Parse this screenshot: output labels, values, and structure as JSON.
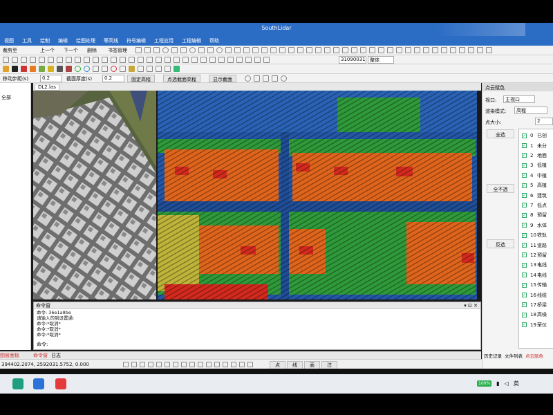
{
  "window": {
    "title": "SouthLidar"
  },
  "menu": [
    "视图",
    "工具",
    "绘制",
    "编辑",
    "绘图处理",
    "等高线",
    "符号编辑",
    "工程应用",
    "工程编辑",
    "帮助"
  ],
  "toolbar1": {
    "items": [
      "裁剪至",
      "上一个",
      "下一个",
      "删除",
      "书签管理"
    ],
    "code_value": "31090031",
    "code_mode": "整体"
  },
  "toolbar3": {
    "step_label": "移动步距(s)",
    "step_value": "0.2",
    "thickness_label": "截面厚度(s)",
    "thickness_value": "0.2",
    "btn_fix_elevation": "固定高程",
    "btn_pick_elevation": "点选截面高程",
    "btn_show_section": "显示截面"
  },
  "left_panel": {
    "label": "全部"
  },
  "doc_tab": "DL2.las",
  "command_window": {
    "header": "命令窗",
    "lines": [
      "命令: 36e1a8be",
      "请输入的到设置通:",
      "命令:*取消*",
      "命令:*取消*",
      "命令:*取消*"
    ],
    "prompt": "命令:"
  },
  "bottom_tabs": {
    "left": "图层面板",
    "cmd": "命令窗",
    "log": "日志"
  },
  "status": {
    "coords": "394402.2074, 2592031.5752, 0.000",
    "group_buttons": [
      "点",
      "线",
      "面",
      "注"
    ]
  },
  "right_panel": {
    "title": "点云赋色",
    "view_label": "视口:",
    "view_value": "主视口",
    "render_label": "渲染模式:",
    "render_value": "高程",
    "size_label": "点大小:",
    "size_value": "2",
    "btn_select_all": "全选",
    "btn_select_none": "全不选",
    "btn_invert": "反选",
    "classes": [
      {
        "num": "0",
        "name": "已创"
      },
      {
        "num": "1",
        "name": "未分"
      },
      {
        "num": "2",
        "name": "地面"
      },
      {
        "num": "3",
        "name": "低植"
      },
      {
        "num": "4",
        "name": "中植"
      },
      {
        "num": "5",
        "name": "高植"
      },
      {
        "num": "6",
        "name": "建筑"
      },
      {
        "num": "7",
        "name": "低点"
      },
      {
        "num": "8",
        "name": "预留"
      },
      {
        "num": "9",
        "name": "水体"
      },
      {
        "num": "10",
        "name": "铁轨"
      },
      {
        "num": "11",
        "name": "道路"
      },
      {
        "num": "12",
        "name": "预留"
      },
      {
        "num": "13",
        "name": "电线"
      },
      {
        "num": "14",
        "name": "电线"
      },
      {
        "num": "15",
        "name": "传输"
      },
      {
        "num": "16",
        "name": "线缆"
      },
      {
        "num": "17",
        "name": "桥梁"
      },
      {
        "num": "18",
        "name": "高噪"
      },
      {
        "num": "19",
        "name": "荣仪"
      }
    ],
    "bottom_tabs": [
      "历史记录",
      "文件列表",
      "点云赋色"
    ]
  },
  "taskbar": {
    "battery": "100%",
    "ime": "英"
  },
  "colors": {
    "titlebar": "#2b6cc4",
    "cloud_blue": "#2457a8",
    "cloud_green": "#2f9a3a",
    "cloud_orange": "#e0651c",
    "cloud_red": "#d42a1e"
  }
}
